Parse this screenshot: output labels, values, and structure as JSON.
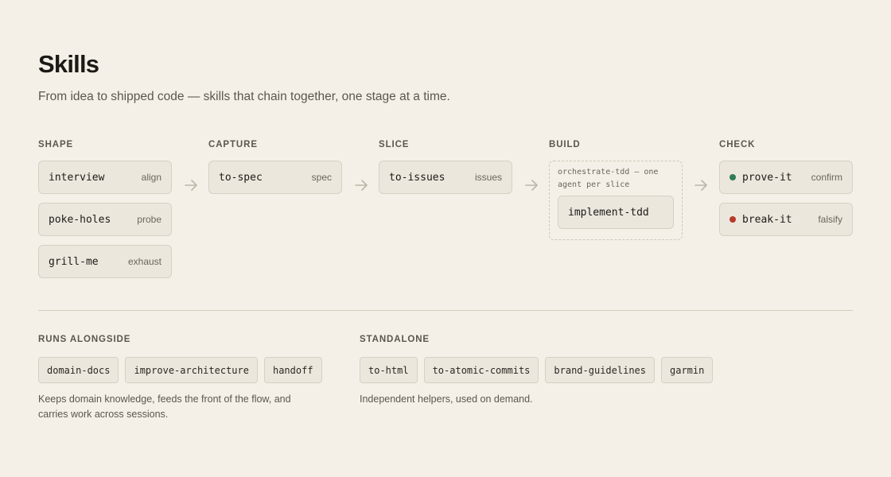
{
  "header": {
    "title": "Skills",
    "subtitle": "From idea to shipped code — skills that chain together, one stage at a time."
  },
  "colors": {
    "background": "#f5f0e7",
    "card": "#ece7dd",
    "confirm_dot": "#2f7d57",
    "falsify_dot": "#b8392b"
  },
  "stages": [
    {
      "label": "SHAPE",
      "skills": [
        {
          "name": "interview",
          "tag": "align"
        },
        {
          "name": "poke-holes",
          "tag": "probe"
        },
        {
          "name": "grill-me",
          "tag": "exhaust"
        }
      ]
    },
    {
      "label": "CAPTURE",
      "skills": [
        {
          "name": "to-spec",
          "tag": "spec"
        }
      ]
    },
    {
      "label": "SLICE",
      "skills": [
        {
          "name": "to-issues",
          "tag": "issues"
        }
      ]
    },
    {
      "label": "BUILD",
      "group_note": "orchestrate-tdd — one agent per slice",
      "skills": [
        {
          "name": "implement-tdd"
        }
      ]
    },
    {
      "label": "CHECK",
      "skills": [
        {
          "name": "prove-it",
          "tag": "confirm",
          "dot": "green"
        },
        {
          "name": "break-it",
          "tag": "falsify",
          "dot": "red"
        }
      ]
    }
  ],
  "runs_alongside": {
    "label": "RUNS ALONGSIDE",
    "chips": [
      "domain-docs",
      "improve-architecture",
      "handoff"
    ],
    "description": "Keeps domain knowledge, feeds the front of the flow, and carries work across sessions."
  },
  "standalone": {
    "label": "STANDALONE",
    "chips": [
      "to-html",
      "to-atomic-commits",
      "brand-guidelines",
      "garmin"
    ],
    "description": "Independent helpers, used on demand."
  }
}
